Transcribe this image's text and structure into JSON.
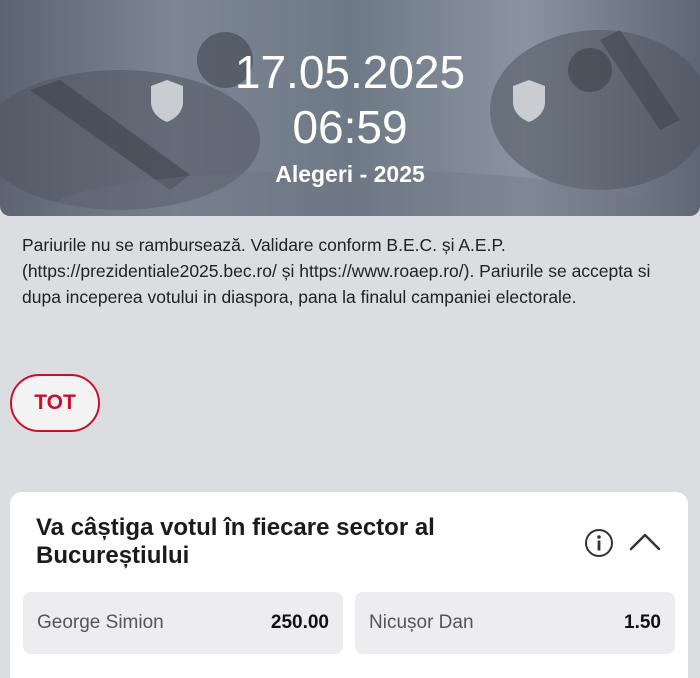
{
  "event": {
    "date": "17.05.2025",
    "time": "06:59",
    "title": "Alegeri - 2025"
  },
  "description": "Pariurile nu se rambursează. Validare conform B.E.C. și A.E.P. (https://prezidentiale2025.bec.ro/ și https://www.roaep.ro/). Pariurile se accepta si dupa inceperea votului in diaspora, pana la finalul campaniei electorale.",
  "filter": {
    "label": "TOT"
  },
  "market": {
    "title": "Va câștiga votul în fiecare sector al Bucureștiului",
    "outcomes": [
      {
        "name": "George Simion",
        "odd": "250.00"
      },
      {
        "name": "Nicușor Dan",
        "odd": "1.50"
      }
    ]
  },
  "colors": {
    "accent": "#c8102e",
    "background": "#dcdde0",
    "card": "#ffffff",
    "outcome_bg": "#ededef"
  },
  "icons": [
    "shield-icon",
    "info-icon",
    "chevron-up-icon"
  ]
}
